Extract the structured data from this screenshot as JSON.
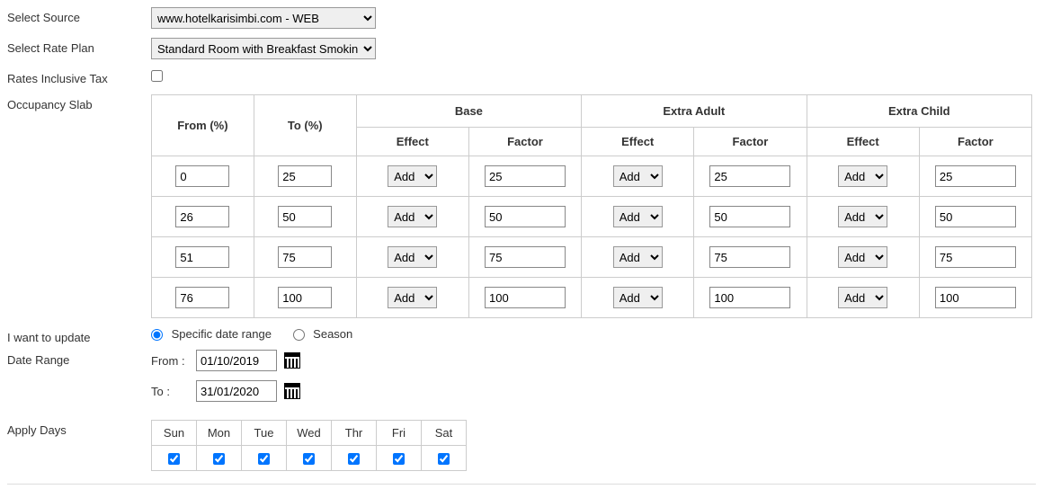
{
  "labels": {
    "selectSource": "Select Source",
    "selectRatePlan": "Select Rate Plan",
    "ratesInclusiveTax": "Rates Inclusive Tax",
    "occupancySlab": "Occupancy Slab",
    "iWantToUpdate": "I want to update",
    "dateRange": "Date Range",
    "applyDays": "Apply Days",
    "from": "From :",
    "to": "To :"
  },
  "source": {
    "value": "www.hotelkarisimbi.com - WEB"
  },
  "ratePlan": {
    "value": "Standard Room with Breakfast Smokin"
  },
  "ratesInclusiveTax": false,
  "slab": {
    "headers": {
      "fromPct": "From (%)",
      "toPct": "To (%)",
      "base": "Base",
      "extraAdult": "Extra Adult",
      "extraChild": "Extra Child",
      "effect": "Effect",
      "factor": "Factor"
    },
    "rows": [
      {
        "from": "0",
        "to": "25",
        "baseEffect": "Add",
        "baseFactor": "25",
        "adultEffect": "Add",
        "adultFactor": "25",
        "childEffect": "Add",
        "childFactor": "25"
      },
      {
        "from": "26",
        "to": "50",
        "baseEffect": "Add",
        "baseFactor": "50",
        "adultEffect": "Add",
        "adultFactor": "50",
        "childEffect": "Add",
        "childFactor": "50"
      },
      {
        "from": "51",
        "to": "75",
        "baseEffect": "Add",
        "baseFactor": "75",
        "adultEffect": "Add",
        "adultFactor": "75",
        "childEffect": "Add",
        "childFactor": "75"
      },
      {
        "from": "76",
        "to": "100",
        "baseEffect": "Add",
        "baseFactor": "100",
        "adultEffect": "Add",
        "adultFactor": "100",
        "childEffect": "Add",
        "childFactor": "100"
      }
    ]
  },
  "updateMode": {
    "options": {
      "specific": "Specific date range",
      "season": "Season"
    },
    "selected": "specific"
  },
  "dateRange": {
    "from": "01/10/2019",
    "to": "31/01/2020"
  },
  "days": {
    "names": {
      "sun": "Sun",
      "mon": "Mon",
      "tue": "Tue",
      "wed": "Wed",
      "thr": "Thr",
      "fri": "Fri",
      "sat": "Sat"
    },
    "checked": {
      "sun": true,
      "mon": true,
      "tue": true,
      "wed": true,
      "thr": true,
      "fri": true,
      "sat": true
    }
  }
}
